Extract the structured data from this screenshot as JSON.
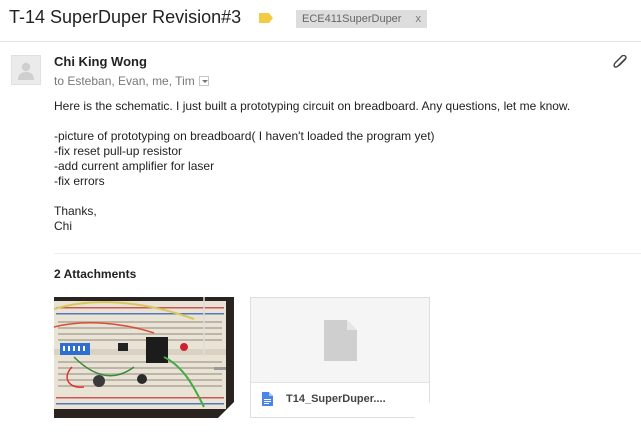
{
  "subject": "T-14 SuperDuper Revision#3",
  "label_chip": {
    "text": "ECE411SuperDuper",
    "remove": "x"
  },
  "colors": {
    "label_tag": "#f2cb43",
    "doc_icon_blue": "#4a86e8",
    "file_placeholder_gray": "#cfcfcf"
  },
  "message": {
    "sender": "Chi King Wong",
    "recipients": "to Esteban, Evan, me, Tim",
    "body": {
      "intro": "Here is the schematic.  I just built a prototyping circuit on breadboard.  Any questions, let me know.",
      "items": [
        "-picture of prototyping on breadboard( I haven't loaded the program yet)",
        "-fix reset pull-up resistor",
        "-add current amplifier for laser",
        "-fix errors"
      ],
      "signoff": "Thanks,",
      "signature": "Chi"
    }
  },
  "attachments": {
    "heading": "2 Attachments",
    "items": [
      {
        "type": "image",
        "icon": "breadboard-photo"
      },
      {
        "type": "file",
        "icon": "document-icon",
        "name": "T14_SuperDuper...."
      }
    ]
  },
  "icons": [
    "label-tag-icon",
    "avatar-icon",
    "dropdown-icon",
    "paperclip-icon",
    "document-icon"
  ]
}
